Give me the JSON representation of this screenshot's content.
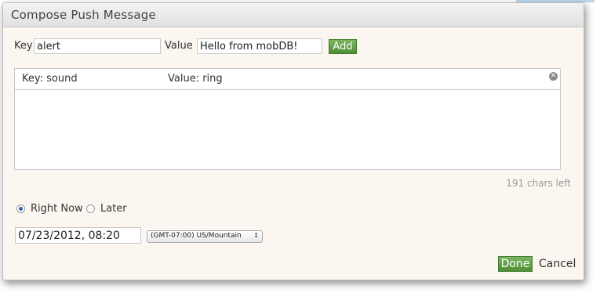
{
  "dialog": {
    "title": "Compose Push Message",
    "key_label": "Key",
    "key_value": "alert",
    "value_label": "Value",
    "value_value": "Hello from mobDB!",
    "add_label": "Add"
  },
  "pairs": [
    {
      "key_text": "Key:  sound",
      "value_text": "Value: ring"
    }
  ],
  "remove_icon": "close-circle-icon",
  "chars_left": "191 chars left",
  "schedule": {
    "right_now_label": "Right Now",
    "later_label": "Later",
    "selected": "Right Now",
    "datetime": "07/23/2012, 08:20",
    "timezone": "(GMT-07:00) US/Mountain"
  },
  "footer": {
    "done_label": "Done",
    "cancel_label": "Cancel"
  },
  "colors": {
    "accent_green": "#5c9c40",
    "dialog_bg": "#fbf6f0",
    "radio_selected": "#3a5fae"
  }
}
